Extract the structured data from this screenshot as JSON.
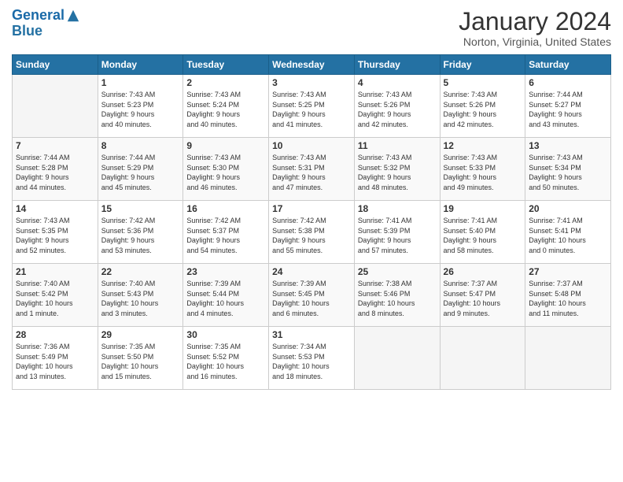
{
  "header": {
    "logo_line1": "General",
    "logo_line2": "Blue",
    "title": "January 2024",
    "subtitle": "Norton, Virginia, United States"
  },
  "weekdays": [
    "Sunday",
    "Monday",
    "Tuesday",
    "Wednesday",
    "Thursday",
    "Friday",
    "Saturday"
  ],
  "weeks": [
    [
      {
        "day": "",
        "info": ""
      },
      {
        "day": "1",
        "info": "Sunrise: 7:43 AM\nSunset: 5:23 PM\nDaylight: 9 hours\nand 40 minutes."
      },
      {
        "day": "2",
        "info": "Sunrise: 7:43 AM\nSunset: 5:24 PM\nDaylight: 9 hours\nand 40 minutes."
      },
      {
        "day": "3",
        "info": "Sunrise: 7:43 AM\nSunset: 5:25 PM\nDaylight: 9 hours\nand 41 minutes."
      },
      {
        "day": "4",
        "info": "Sunrise: 7:43 AM\nSunset: 5:26 PM\nDaylight: 9 hours\nand 42 minutes."
      },
      {
        "day": "5",
        "info": "Sunrise: 7:43 AM\nSunset: 5:26 PM\nDaylight: 9 hours\nand 42 minutes."
      },
      {
        "day": "6",
        "info": "Sunrise: 7:44 AM\nSunset: 5:27 PM\nDaylight: 9 hours\nand 43 minutes."
      }
    ],
    [
      {
        "day": "7",
        "info": "Sunrise: 7:44 AM\nSunset: 5:28 PM\nDaylight: 9 hours\nand 44 minutes."
      },
      {
        "day": "8",
        "info": "Sunrise: 7:44 AM\nSunset: 5:29 PM\nDaylight: 9 hours\nand 45 minutes."
      },
      {
        "day": "9",
        "info": "Sunrise: 7:43 AM\nSunset: 5:30 PM\nDaylight: 9 hours\nand 46 minutes."
      },
      {
        "day": "10",
        "info": "Sunrise: 7:43 AM\nSunset: 5:31 PM\nDaylight: 9 hours\nand 47 minutes."
      },
      {
        "day": "11",
        "info": "Sunrise: 7:43 AM\nSunset: 5:32 PM\nDaylight: 9 hours\nand 48 minutes."
      },
      {
        "day": "12",
        "info": "Sunrise: 7:43 AM\nSunset: 5:33 PM\nDaylight: 9 hours\nand 49 minutes."
      },
      {
        "day": "13",
        "info": "Sunrise: 7:43 AM\nSunset: 5:34 PM\nDaylight: 9 hours\nand 50 minutes."
      }
    ],
    [
      {
        "day": "14",
        "info": "Sunrise: 7:43 AM\nSunset: 5:35 PM\nDaylight: 9 hours\nand 52 minutes."
      },
      {
        "day": "15",
        "info": "Sunrise: 7:42 AM\nSunset: 5:36 PM\nDaylight: 9 hours\nand 53 minutes."
      },
      {
        "day": "16",
        "info": "Sunrise: 7:42 AM\nSunset: 5:37 PM\nDaylight: 9 hours\nand 54 minutes."
      },
      {
        "day": "17",
        "info": "Sunrise: 7:42 AM\nSunset: 5:38 PM\nDaylight: 9 hours\nand 55 minutes."
      },
      {
        "day": "18",
        "info": "Sunrise: 7:41 AM\nSunset: 5:39 PM\nDaylight: 9 hours\nand 57 minutes."
      },
      {
        "day": "19",
        "info": "Sunrise: 7:41 AM\nSunset: 5:40 PM\nDaylight: 9 hours\nand 58 minutes."
      },
      {
        "day": "20",
        "info": "Sunrise: 7:41 AM\nSunset: 5:41 PM\nDaylight: 10 hours\nand 0 minutes."
      }
    ],
    [
      {
        "day": "21",
        "info": "Sunrise: 7:40 AM\nSunset: 5:42 PM\nDaylight: 10 hours\nand 1 minute."
      },
      {
        "day": "22",
        "info": "Sunrise: 7:40 AM\nSunset: 5:43 PM\nDaylight: 10 hours\nand 3 minutes."
      },
      {
        "day": "23",
        "info": "Sunrise: 7:39 AM\nSunset: 5:44 PM\nDaylight: 10 hours\nand 4 minutes."
      },
      {
        "day": "24",
        "info": "Sunrise: 7:39 AM\nSunset: 5:45 PM\nDaylight: 10 hours\nand 6 minutes."
      },
      {
        "day": "25",
        "info": "Sunrise: 7:38 AM\nSunset: 5:46 PM\nDaylight: 10 hours\nand 8 minutes."
      },
      {
        "day": "26",
        "info": "Sunrise: 7:37 AM\nSunset: 5:47 PM\nDaylight: 10 hours\nand 9 minutes."
      },
      {
        "day": "27",
        "info": "Sunrise: 7:37 AM\nSunset: 5:48 PM\nDaylight: 10 hours\nand 11 minutes."
      }
    ],
    [
      {
        "day": "28",
        "info": "Sunrise: 7:36 AM\nSunset: 5:49 PM\nDaylight: 10 hours\nand 13 minutes."
      },
      {
        "day": "29",
        "info": "Sunrise: 7:35 AM\nSunset: 5:50 PM\nDaylight: 10 hours\nand 15 minutes."
      },
      {
        "day": "30",
        "info": "Sunrise: 7:35 AM\nSunset: 5:52 PM\nDaylight: 10 hours\nand 16 minutes."
      },
      {
        "day": "31",
        "info": "Sunrise: 7:34 AM\nSunset: 5:53 PM\nDaylight: 10 hours\nand 18 minutes."
      },
      {
        "day": "",
        "info": ""
      },
      {
        "day": "",
        "info": ""
      },
      {
        "day": "",
        "info": ""
      }
    ]
  ]
}
